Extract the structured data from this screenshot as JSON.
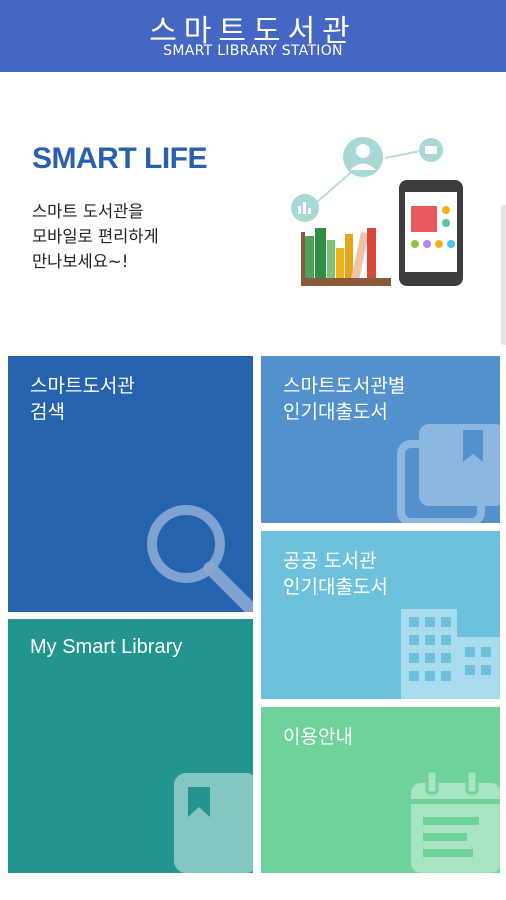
{
  "header": {
    "title": "스마트도서관",
    "subtitle": "SMART LIBRARY STATION",
    "background": "#4567c4"
  },
  "hero": {
    "headline": "SMART LIFE",
    "description": "스마트 도서관을\n모바일로 편리하게\n만나보세요~!",
    "headline_color": "#2a5fb0"
  },
  "menu": {
    "search": {
      "label": "스마트도서관\n검색",
      "icon": "magnifier-icon",
      "color": "#2563ae"
    },
    "my_library": {
      "label": "My Smart Library",
      "icon": "bookmark-book-icon",
      "color": "#22958e"
    },
    "popular_station": {
      "label": "스마트도서관별\n인기대출도서",
      "icon": "books-icon",
      "color": "#5391cd"
    },
    "popular_public": {
      "label": "공공 도서관\n인기대출도서",
      "icon": "building-icon",
      "color": "#6ec1dd"
    },
    "guide": {
      "label": "이용안내",
      "icon": "calendar-icon",
      "color": "#6fd29b"
    }
  }
}
